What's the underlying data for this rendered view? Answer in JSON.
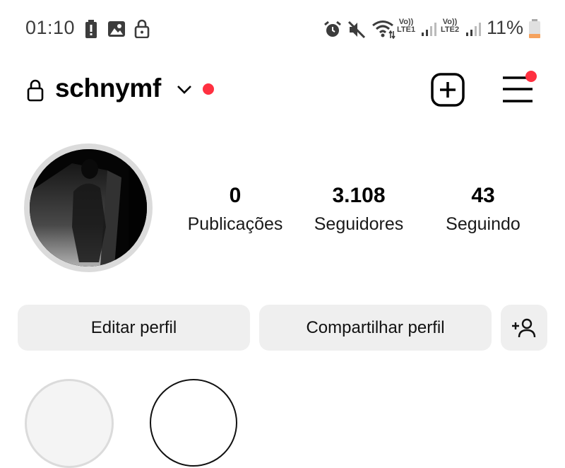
{
  "status_bar": {
    "time": "01:10",
    "sim1": {
      "top": "Vo))",
      "bottom": "LTE1"
    },
    "sim2": {
      "top": "Vo))",
      "bottom": "LTE2"
    },
    "battery_percent": "11%",
    "icons": [
      "battery-alert-icon",
      "image-icon",
      "lock-icon",
      "alarm-icon",
      "mute-icon",
      "wifi-icon",
      "signal-icon",
      "battery-icon"
    ]
  },
  "header": {
    "username": "schnymf",
    "icons": [
      "lock-icon",
      "chevron-down-icon",
      "notification-dot",
      "create-post-icon",
      "menu-icon"
    ]
  },
  "profile": {
    "stats": [
      {
        "value": "0",
        "label": "Publicações"
      },
      {
        "value": "3.108",
        "label": "Seguidores"
      },
      {
        "value": "43",
        "label": "Seguindo"
      }
    ]
  },
  "actions": {
    "edit_label": "Editar perfil",
    "share_label": "Compartilhar perfil",
    "discover_icon": "add-person-icon"
  },
  "colors": {
    "notification": "#ff3040",
    "button_bg": "#efefef",
    "avatar_ring": "#dbdbdb"
  }
}
